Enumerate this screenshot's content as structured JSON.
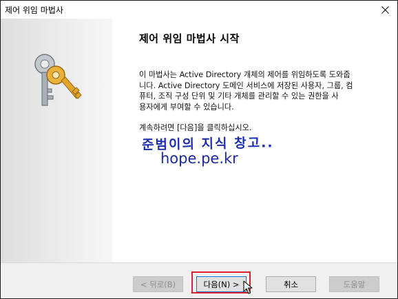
{
  "window": {
    "title": "제어 위임 마법사"
  },
  "page": {
    "heading": "제어 위임 마법사 시작",
    "description": "이 마법사는 Active Directory 개체의 제어를 위임하도록 도와줍\n니다. Active Directory 도메인 서비스에 저장된 사용자, 그룹, 컴\n퓨터, 조직 구성 단위 및 기타 개체를 관리할 수 있는 권한을 사\n용자에게 부여할 수 있습니다.",
    "continue_text": "계속하려면 [다음]을 클릭하십시오."
  },
  "watermark": {
    "line1": "준범이의 지식 창고..",
    "line2": "hope.pe.kr"
  },
  "buttons": {
    "back": "< 뒤로(B)",
    "next": "다음(N) >",
    "cancel": "취소",
    "help": "도움말"
  },
  "colors": {
    "highlight": "#e0202a",
    "watermark": "#1c2fb3",
    "key_gold": "#e0a52a",
    "key_silver": "#a9b0b8"
  },
  "icons": {
    "close": "close-icon",
    "keys": "keys-icon",
    "cursor": "mouse-cursor-icon"
  }
}
